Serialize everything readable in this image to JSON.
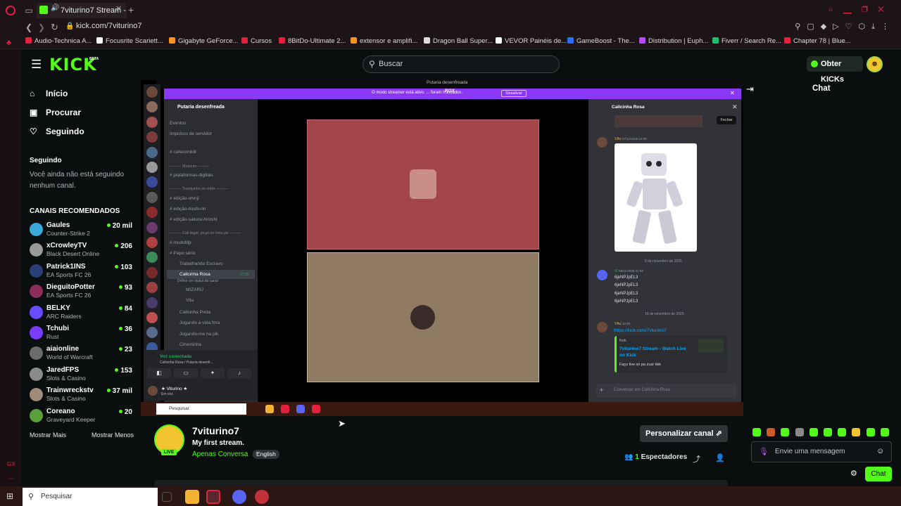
{
  "browser": {
    "tab_title": "7viturino7 Stream - W",
    "url": "kick.com/7viturino7",
    "bookmarks": [
      {
        "label": "Audio-Technica A...",
        "color": "#e3203e"
      },
      {
        "label": "Focusrite Scariett...",
        "color": "#ffffff"
      },
      {
        "label": "Gigabyte GeForce...",
        "color": "#f7931e"
      },
      {
        "label": "Cursos",
        "color": "#e3203e"
      },
      {
        "label": "8BitDo-Ultimate 2...",
        "color": "#e3203e"
      },
      {
        "label": "extensor e amplifi...",
        "color": "#f7931e"
      },
      {
        "label": "Dragon Ball Super...",
        "color": "#dddddd"
      },
      {
        "label": "VEVOR Painéis de...",
        "color": "#ffffff"
      },
      {
        "label": "GameBoost - The...",
        "color": "#2f6bff"
      },
      {
        "label": "Distribution | Euph...",
        "color": "#b54bff"
      },
      {
        "label": "Fiverr / Search Re...",
        "color": "#1dbf73"
      },
      {
        "label": "Chapter 78 | Blue...",
        "color": "#e3203e"
      }
    ]
  },
  "kick": {
    "logo": "KICK",
    "beta": "BETA",
    "search_placeholder": "Buscar",
    "get_kicks": "Obter KICKs",
    "nav": [
      {
        "label": "Início",
        "icon": "home-icon"
      },
      {
        "label": "Procurar",
        "icon": "browse-icon"
      },
      {
        "label": "Seguindo",
        "icon": "heart-icon"
      }
    ],
    "following_title": "Seguindo",
    "following_empty": "Você ainda não está seguindo nenhum canal.",
    "recommended_title": "CANAIS RECOMENDADOS",
    "channels": [
      {
        "name": "Gaules",
        "game": "Counter-Strike 2",
        "viewers": "20 mil",
        "color": "#3aa8d8"
      },
      {
        "name": "xCrowleyTV",
        "game": "Black Desert Online",
        "viewers": "206",
        "color": "#9a9a9a"
      },
      {
        "name": "Patrick1INS",
        "game": "EA Sports FC 26",
        "viewers": "103",
        "color": "#2c3e78"
      },
      {
        "name": "DieguitoPotter",
        "game": "EA Sports FC 26",
        "viewers": "93",
        "color": "#8a2d5a"
      },
      {
        "name": "BELKY",
        "game": "ARC Raiders",
        "viewers": "84",
        "color": "#6a4cff"
      },
      {
        "name": "Tchubi",
        "game": "Rust",
        "viewers": "36",
        "color": "#7a3cff"
      },
      {
        "name": "aiaionline",
        "game": "World of Warcraft",
        "viewers": "23",
        "color": "#6b6b6b"
      },
      {
        "name": "JaredFPS",
        "game": "Slots & Casino",
        "viewers": "153",
        "color": "#8a8a8a"
      },
      {
        "name": "Trainwreckstv",
        "game": "Slots & Casino",
        "viewers": "37 mil",
        "color": "#a08a7a"
      },
      {
        "name": "Coreano",
        "game": "Graveyard Keeper",
        "viewers": "20",
        "color": "#5aa03a"
      }
    ],
    "show_more": "Mostrar Mais",
    "show_less": "Mostrar Menos",
    "stream": {
      "name": "7viturino7",
      "title": "My first stream.",
      "category": "Apenas Conversa",
      "language": "English",
      "live": "LIVE",
      "customize": "Personalizar canal",
      "viewers": "1",
      "viewers_label": "Espectadores"
    },
    "chat": {
      "title": "Chat",
      "placeholder": "Envie uma mensagem",
      "send": "Chat"
    }
  },
  "discord": {
    "window_title": "Putaria desenfreada",
    "banner": "O modo streamer está ativo. ... foram truncados.",
    "banner_button": "Desativar",
    "rgx": "RGX",
    "server_name": "Putaria desenfreada",
    "channels": [
      {
        "label": "Eventos",
        "type": "ch"
      },
      {
        "label": "Impulsos de servidor",
        "type": "ch"
      },
      {
        "label": "# cafecomkill",
        "type": "ch"
      },
      {
        "label": "——— Músicas ———",
        "type": "cat"
      },
      {
        "label": "# plataformas-digitais",
        "type": "ch"
      },
      {
        "label": "——— Trampinho do edits ———",
        "type": "cat"
      },
      {
        "label": "# edição-shinji",
        "type": "ch"
      },
      {
        "label": "# edição-itoshi-rin",
        "type": "ch"
      },
      {
        "label": "# edição-sakura-hiroshi",
        "type": "ch"
      },
      {
        "label": "——— Call legal, pega no meu pé ———",
        "type": "cat"
      },
      {
        "label": "# mudofdp",
        "type": "ch"
      },
      {
        "label": "# Papo sério",
        "type": "ch"
      },
      {
        "label": "Trabalhando Escravo",
        "type": "ch"
      },
      {
        "label": "Callcinha Rosa",
        "type": "active"
      },
      {
        "label": "MIZARU",
        "type": "ch"
      },
      {
        "label": "Vitu",
        "type": "ch"
      },
      {
        "label": "Callcinha Preta",
        "type": "ch"
      },
      {
        "label": "Jogando a vida fora",
        "type": "ch"
      },
      {
        "label": "Jogando-me na pik",
        "type": "ch"
      },
      {
        "label": "Cineminha",
        "type": "ch"
      }
    ],
    "active_time": "27:20",
    "active_sub": "Definir um status do canal",
    "voice_connected": "Voz conectada",
    "voice_sub": "Callcinha Rosa / Putaria desenfr...",
    "user": "★ Viturino ★",
    "user_status": "Em voz",
    "chat_channel": "Callcinha Rosa",
    "close_tip": "Fechar",
    "vitu": "Vitu",
    "vitu_time1": "07/11/2025 22:08",
    "date1": "9 de novembro de 2025",
    "m_name": "M",
    "m_time": "09/11/2025 01:32",
    "m_lines": [
      "6jeNPJpEL3",
      "6jeNPJpEL3",
      "6jeNPJpEL3",
      "6jeNPJpEL3"
    ],
    "date2": "16 de novembro de 2025",
    "vitu_time2": "10:39",
    "link": "https://kick.com/7viturino7",
    "embed_site": "Kick",
    "embed_title": "7viturino7 Stream - Watch Live on Kick",
    "embed_desc": "Faço live só pa zuar kkk",
    "input_placeholder": "Conversar em  Callcinha Rosa",
    "inner_search": "Pesquisar"
  },
  "os": {
    "search_placeholder": "Pesquisar"
  },
  "colors": {
    "kick_green": "#53fc18",
    "opera_red": "#e3203e",
    "discord_purple": "#8a38f5"
  }
}
